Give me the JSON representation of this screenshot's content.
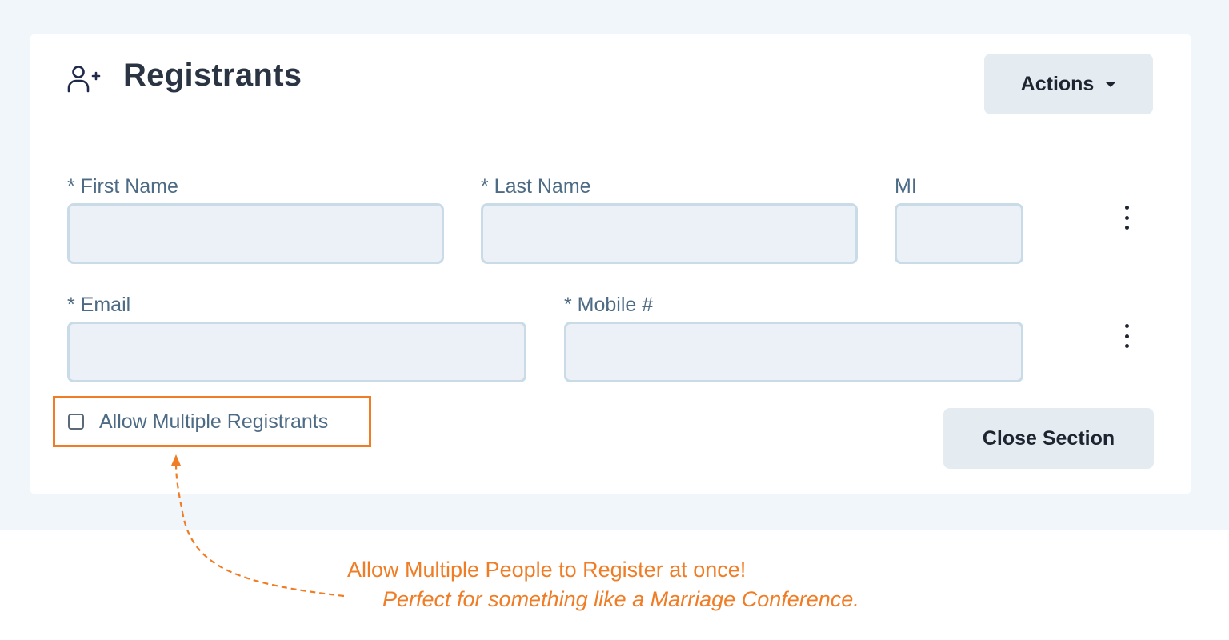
{
  "header": {
    "title": "Registrants",
    "icon": "add-user-icon",
    "actions_label": "Actions"
  },
  "form": {
    "first_name": {
      "label": "* First Name",
      "value": ""
    },
    "last_name": {
      "label": "* Last Name",
      "value": ""
    },
    "mi": {
      "label": "MI",
      "value": ""
    },
    "email": {
      "label": "* Email",
      "value": ""
    },
    "mobile": {
      "label": "* Mobile #",
      "value": ""
    }
  },
  "allow_multiple": {
    "label": "Allow Multiple Registrants",
    "checked": false
  },
  "close_section_label": "Close Section",
  "callout": {
    "line1": "Allow Multiple People to Register at once!",
    "line2": "Perfect for something like a Marriage Conference."
  },
  "colors": {
    "accent": "#f07d26",
    "page_bg": "#f1f6fa",
    "input_bg": "#ebf1f7",
    "input_border": "#c9dbe7",
    "label": "#4d6b85",
    "button_bg": "#e4ecf2"
  }
}
